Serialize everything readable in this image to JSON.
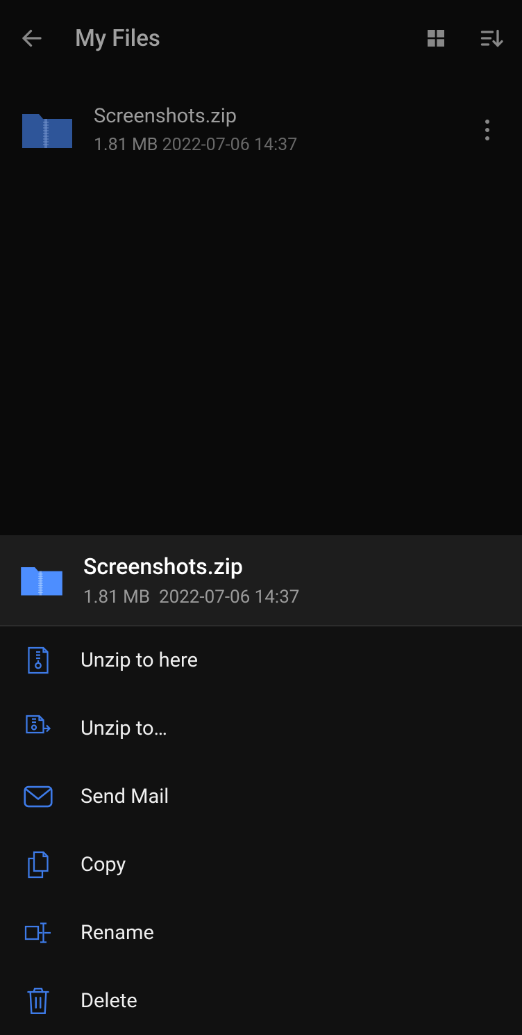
{
  "header": {
    "title": "My Files"
  },
  "file": {
    "name": "Screenshots.zip",
    "size": "1.81 MB",
    "date": "2022-07-06 14:37"
  },
  "sheet": {
    "name": "Screenshots.zip",
    "size": "1.81 MB",
    "date": "2022-07-06 14:37"
  },
  "menu": {
    "unzip_here": "Unzip to here",
    "unzip_to": "Unzip to…",
    "send_mail": "Send Mail",
    "copy": "Copy",
    "rename": "Rename",
    "delete": "Delete"
  },
  "colors": {
    "accent": "#3e7be8",
    "accent_light": "#4d8eff"
  }
}
